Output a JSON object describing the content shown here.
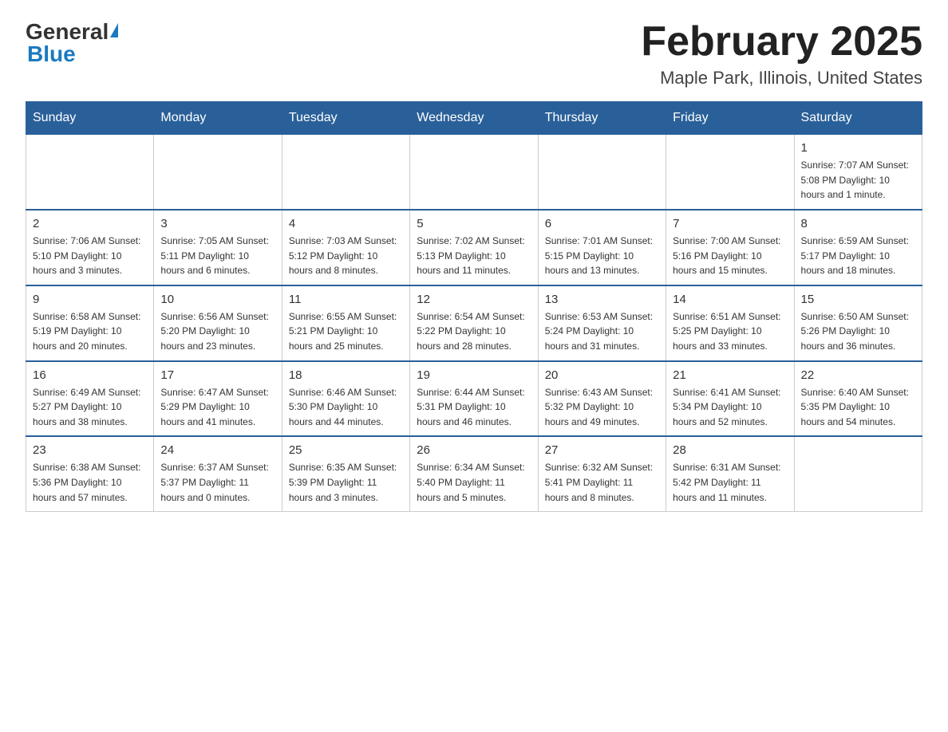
{
  "header": {
    "logo_general": "General",
    "logo_blue": "Blue",
    "month_title": "February 2025",
    "location": "Maple Park, Illinois, United States"
  },
  "weekdays": [
    "Sunday",
    "Monday",
    "Tuesday",
    "Wednesday",
    "Thursday",
    "Friday",
    "Saturday"
  ],
  "weeks": [
    [
      {
        "day": "",
        "info": ""
      },
      {
        "day": "",
        "info": ""
      },
      {
        "day": "",
        "info": ""
      },
      {
        "day": "",
        "info": ""
      },
      {
        "day": "",
        "info": ""
      },
      {
        "day": "",
        "info": ""
      },
      {
        "day": "1",
        "info": "Sunrise: 7:07 AM\nSunset: 5:08 PM\nDaylight: 10 hours and 1 minute."
      }
    ],
    [
      {
        "day": "2",
        "info": "Sunrise: 7:06 AM\nSunset: 5:10 PM\nDaylight: 10 hours and 3 minutes."
      },
      {
        "day": "3",
        "info": "Sunrise: 7:05 AM\nSunset: 5:11 PM\nDaylight: 10 hours and 6 minutes."
      },
      {
        "day": "4",
        "info": "Sunrise: 7:03 AM\nSunset: 5:12 PM\nDaylight: 10 hours and 8 minutes."
      },
      {
        "day": "5",
        "info": "Sunrise: 7:02 AM\nSunset: 5:13 PM\nDaylight: 10 hours and 11 minutes."
      },
      {
        "day": "6",
        "info": "Sunrise: 7:01 AM\nSunset: 5:15 PM\nDaylight: 10 hours and 13 minutes."
      },
      {
        "day": "7",
        "info": "Sunrise: 7:00 AM\nSunset: 5:16 PM\nDaylight: 10 hours and 15 minutes."
      },
      {
        "day": "8",
        "info": "Sunrise: 6:59 AM\nSunset: 5:17 PM\nDaylight: 10 hours and 18 minutes."
      }
    ],
    [
      {
        "day": "9",
        "info": "Sunrise: 6:58 AM\nSunset: 5:19 PM\nDaylight: 10 hours and 20 minutes."
      },
      {
        "day": "10",
        "info": "Sunrise: 6:56 AM\nSunset: 5:20 PM\nDaylight: 10 hours and 23 minutes."
      },
      {
        "day": "11",
        "info": "Sunrise: 6:55 AM\nSunset: 5:21 PM\nDaylight: 10 hours and 25 minutes."
      },
      {
        "day": "12",
        "info": "Sunrise: 6:54 AM\nSunset: 5:22 PM\nDaylight: 10 hours and 28 minutes."
      },
      {
        "day": "13",
        "info": "Sunrise: 6:53 AM\nSunset: 5:24 PM\nDaylight: 10 hours and 31 minutes."
      },
      {
        "day": "14",
        "info": "Sunrise: 6:51 AM\nSunset: 5:25 PM\nDaylight: 10 hours and 33 minutes."
      },
      {
        "day": "15",
        "info": "Sunrise: 6:50 AM\nSunset: 5:26 PM\nDaylight: 10 hours and 36 minutes."
      }
    ],
    [
      {
        "day": "16",
        "info": "Sunrise: 6:49 AM\nSunset: 5:27 PM\nDaylight: 10 hours and 38 minutes."
      },
      {
        "day": "17",
        "info": "Sunrise: 6:47 AM\nSunset: 5:29 PM\nDaylight: 10 hours and 41 minutes."
      },
      {
        "day": "18",
        "info": "Sunrise: 6:46 AM\nSunset: 5:30 PM\nDaylight: 10 hours and 44 minutes."
      },
      {
        "day": "19",
        "info": "Sunrise: 6:44 AM\nSunset: 5:31 PM\nDaylight: 10 hours and 46 minutes."
      },
      {
        "day": "20",
        "info": "Sunrise: 6:43 AM\nSunset: 5:32 PM\nDaylight: 10 hours and 49 minutes."
      },
      {
        "day": "21",
        "info": "Sunrise: 6:41 AM\nSunset: 5:34 PM\nDaylight: 10 hours and 52 minutes."
      },
      {
        "day": "22",
        "info": "Sunrise: 6:40 AM\nSunset: 5:35 PM\nDaylight: 10 hours and 54 minutes."
      }
    ],
    [
      {
        "day": "23",
        "info": "Sunrise: 6:38 AM\nSunset: 5:36 PM\nDaylight: 10 hours and 57 minutes."
      },
      {
        "day": "24",
        "info": "Sunrise: 6:37 AM\nSunset: 5:37 PM\nDaylight: 11 hours and 0 minutes."
      },
      {
        "day": "25",
        "info": "Sunrise: 6:35 AM\nSunset: 5:39 PM\nDaylight: 11 hours and 3 minutes."
      },
      {
        "day": "26",
        "info": "Sunrise: 6:34 AM\nSunset: 5:40 PM\nDaylight: 11 hours and 5 minutes."
      },
      {
        "day": "27",
        "info": "Sunrise: 6:32 AM\nSunset: 5:41 PM\nDaylight: 11 hours and 8 minutes."
      },
      {
        "day": "28",
        "info": "Sunrise: 6:31 AM\nSunset: 5:42 PM\nDaylight: 11 hours and 11 minutes."
      },
      {
        "day": "",
        "info": ""
      }
    ]
  ]
}
